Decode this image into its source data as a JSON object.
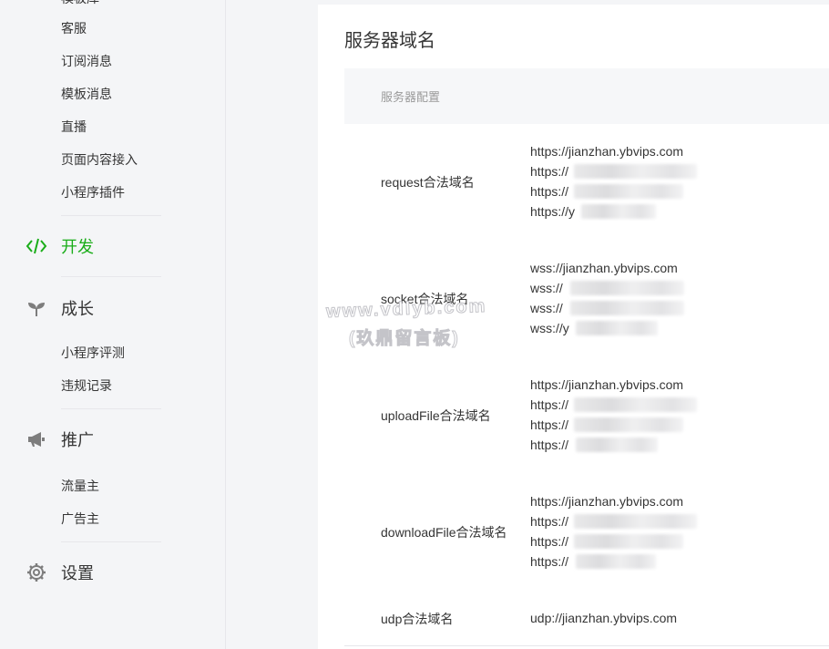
{
  "sidebar": {
    "partial_top_item": "模板库",
    "groups": [
      {
        "items": [
          "客服",
          "订阅消息",
          "模板消息",
          "直播",
          "页面内容接入",
          "小程序插件"
        ]
      },
      {
        "head": {
          "label": "开发",
          "icon": "code-icon",
          "active": true
        }
      },
      {
        "head": {
          "label": "成长",
          "icon": "sprout-icon"
        },
        "items": [
          "小程序评测",
          "违规记录"
        ]
      },
      {
        "head": {
          "label": "推广",
          "icon": "megaphone-icon"
        },
        "items": [
          "流量主",
          "广告主"
        ]
      },
      {
        "head": {
          "label": "设置",
          "icon": "gear-icon"
        }
      }
    ]
  },
  "main": {
    "title": "服务器域名",
    "table_header": "服务器配置",
    "rows": [
      {
        "label": "request合法域名",
        "values": [
          "https://jianzhan.ybvips.com",
          "https://",
          "https://",
          "https://y"
        ]
      },
      {
        "label": "socket合法域名",
        "values": [
          "wss://jianzhan.ybvips.com",
          "wss://",
          "wss://",
          "wss://y"
        ]
      },
      {
        "label": "uploadFile合法域名",
        "values": [
          "https://jianzhan.ybvips.com",
          "https://",
          "https://",
          "https://"
        ]
      },
      {
        "label": "downloadFile合法域名",
        "values": [
          "https://jianzhan.ybvips.com",
          "https://",
          "https://",
          "https://"
        ]
      },
      {
        "label": "udp合法域名",
        "values": [
          "udp://jianzhan.ybvips.com"
        ]
      }
    ]
  },
  "watermark": {
    "line1": "www.vdlyb.com",
    "line2": "(玖鼎留言板)"
  },
  "colors": {
    "accent": "#1aad19",
    "text": "#353535",
    "muted": "#9a9a9a",
    "sidebar_bg": "#f4f5f7"
  }
}
